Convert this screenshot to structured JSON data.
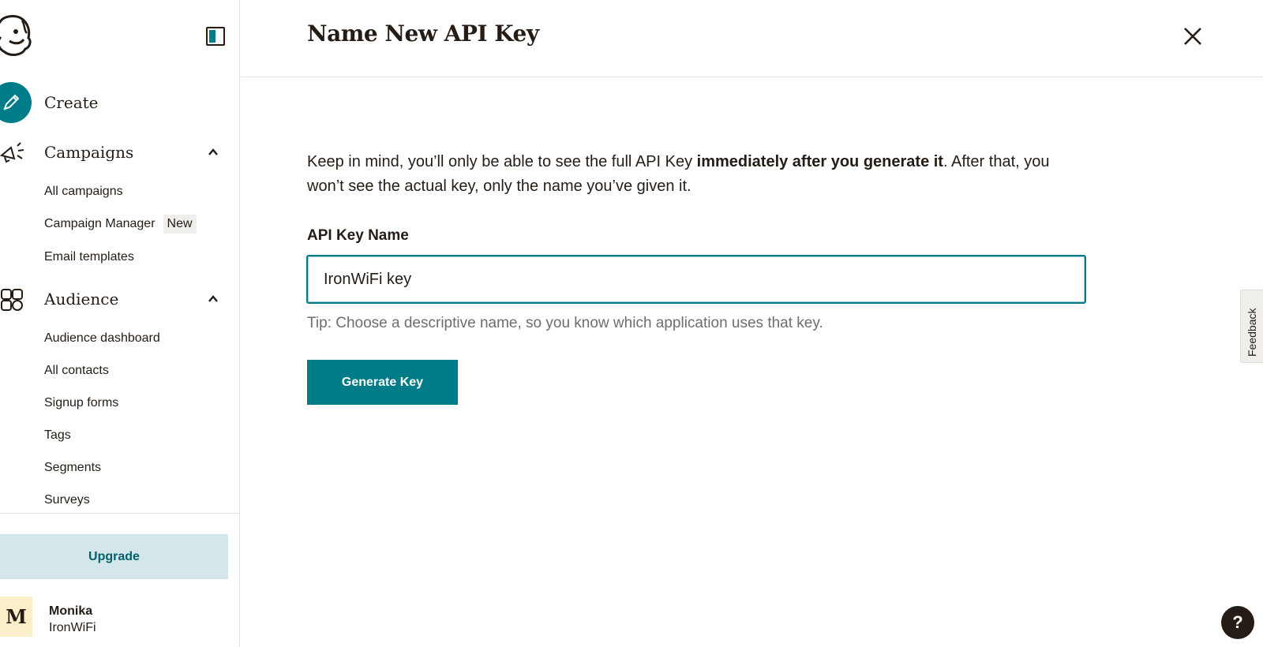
{
  "sidebar": {
    "create_label": "Create",
    "campaigns": {
      "label": "Campaigns",
      "items": [
        "All campaigns",
        "Campaign Manager",
        "Email templates"
      ],
      "new_badge": "New"
    },
    "audience": {
      "label": "Audience",
      "items": [
        "Audience dashboard",
        "All contacts",
        "Signup forms",
        "Tags",
        "Segments",
        "Surveys"
      ]
    },
    "upgrade_label": "Upgrade",
    "user": {
      "avatar_letter": "M",
      "name": "Monika",
      "org": "IronWiFi"
    }
  },
  "modal": {
    "title": "Name New API Key",
    "intro_start": "Keep in mind, you’ll only be able to see the full API Key ",
    "intro_bold": "immediately after you generate it",
    "intro_end": ". After that, you won’t see the actual key, only the name you’ve given it.",
    "field_label": "API Key Name",
    "field_value": "IronWiFi key",
    "tip": "Tip: Choose a descriptive name, so you know which application uses that key.",
    "generate_label": "Generate Key"
  },
  "feedback_label": "Feedback",
  "help_label": "?",
  "colors": {
    "accent": "#007c89",
    "text": "#241c15",
    "upgrade_bg": "#d3e7ea",
    "upgrade_text": "#00606b"
  },
  "icons": [
    "freddie-logo-icon",
    "sidebar-toggle-icon",
    "pencil-icon",
    "megaphone-icon",
    "audience-icon",
    "chevron-up-icon",
    "close-icon",
    "help-icon"
  ]
}
